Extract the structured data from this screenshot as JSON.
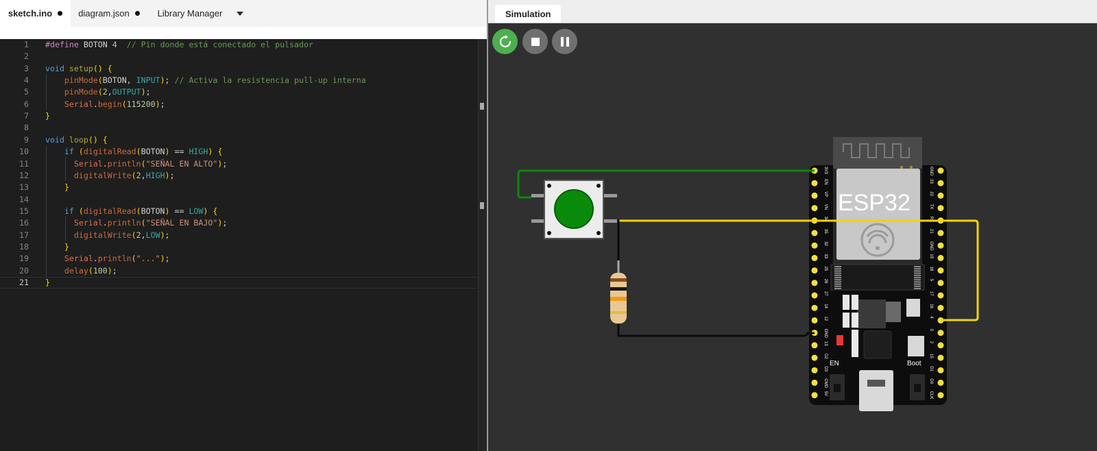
{
  "editor": {
    "tabs": [
      {
        "label": "sketch.ino",
        "modified": true,
        "active": true
      },
      {
        "label": "diagram.json",
        "modified": true,
        "active": false
      },
      {
        "label": "Library Manager",
        "modified": false,
        "active": false
      }
    ],
    "code_lines": [
      "#define BOTON 4  // Pin donde está conectado el pulsador",
      "",
      "void setup() {",
      "    pinMode(BOTON, INPUT); // Activa la resistencia pull-up interna",
      "    pinMode(2,OUTPUT);",
      "    Serial.begin(115200);",
      "}",
      "",
      "void loop() {",
      "    if (digitalRead(BOTON) == HIGH) {",
      "      Serial.println(\"SEÑAL EN ALTO\");",
      "      digitalWrite(2,HIGH);",
      "    }",
      "",
      "    if (digitalRead(BOTON) == LOW) {",
      "      Serial.println(\"SEÑAL EN BAJO\");",
      "      digitalWrite(2,LOW);",
      "    }",
      "    Serial.println(\"...\");",
      "    delay(100);",
      "}"
    ],
    "current_line": 21
  },
  "simulation": {
    "tab_label": "Simulation",
    "controls": [
      {
        "name": "restart",
        "icon": "restart-icon",
        "color": "#4caf50"
      },
      {
        "name": "stop",
        "icon": "stop-icon",
        "color": "#707070"
      },
      {
        "name": "pause",
        "icon": "pause-icon",
        "color": "#707070"
      }
    ],
    "board": {
      "label": "ESP32",
      "button_en": "EN",
      "button_boot": "Boot",
      "left_pins": [
        "3V3",
        "EN",
        "VP",
        "VN",
        "34",
        "35",
        "32",
        "33",
        "25",
        "26",
        "27",
        "14",
        "12",
        "GND",
        "13",
        "D2",
        "D3",
        "CMD",
        "5V"
      ],
      "right_pins": [
        "GND",
        "23",
        "22",
        "TX",
        "RX",
        "21",
        "GND",
        "19",
        "18",
        "5",
        "17",
        "16",
        "4",
        "0",
        "2",
        "15",
        "D1",
        "D0",
        "CLK"
      ]
    },
    "wire_colors": {
      "green": "#0a8a0a",
      "yellow": "#f5d20a",
      "black": "#0a0a0a"
    }
  }
}
